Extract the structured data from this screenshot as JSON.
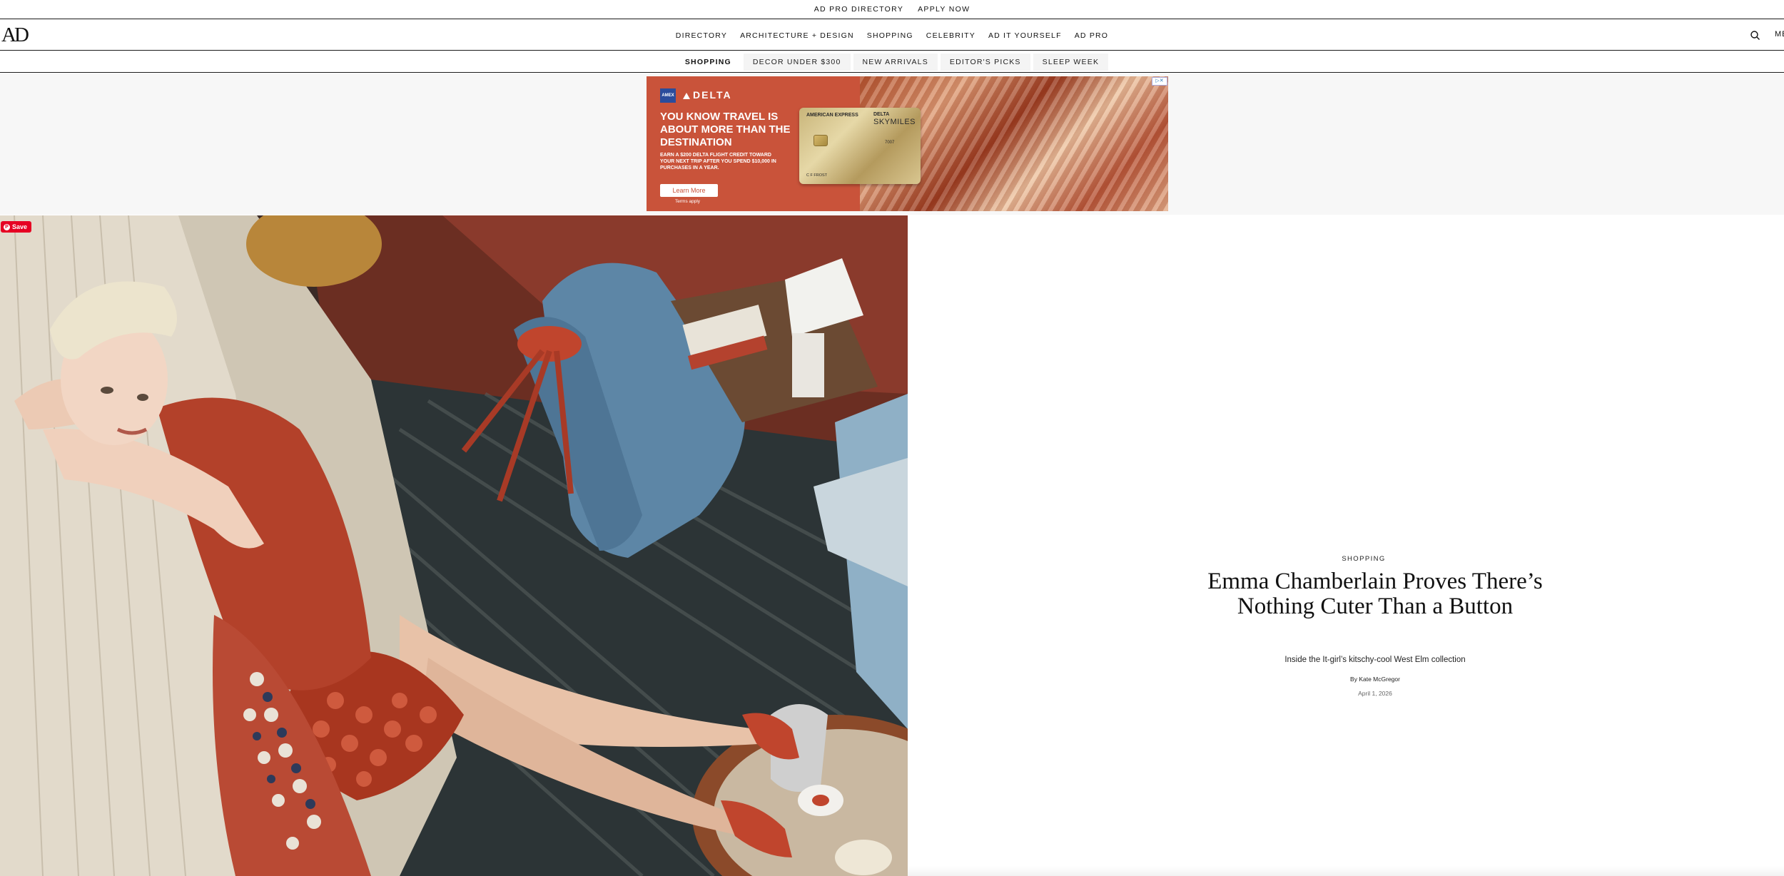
{
  "utility_bar": {
    "links": [
      "AD PRO DIRECTORY",
      "APPLY NOW"
    ]
  },
  "header": {
    "logo": "AD",
    "nav": [
      "DIRECTORY",
      "ARCHITECTURE + DESIGN",
      "SHOPPING",
      "CELEBRITY",
      "AD IT YOURSELF",
      "AD PRO"
    ],
    "menu_label": "MENU",
    "search_icon": "search-icon"
  },
  "sub_nav": {
    "current": "SHOPPING",
    "items": [
      "DECOR UNDER $300",
      "NEW ARRIVALS",
      "EDITOR'S PICKS",
      "SLEEP WEEK"
    ]
  },
  "ad": {
    "brand": "DELTA",
    "badge": "AMEX",
    "headline": "YOU KNOW TRAVEL IS ABOUT MORE THAN THE DESTINATION",
    "body": "EARN A $200 DELTA FLIGHT CREDIT TOWARD YOUR NEXT TRIP AFTER YOU SPEND $10,000 IN PURCHASES IN A YEAR.",
    "cta": "Learn More",
    "terms": "Terms apply",
    "card": {
      "issuer": "AMERICAN EXPRESS",
      "partner": "DELTA",
      "program": "SKYMILES",
      "number": "7007",
      "holder": "C F FROST"
    },
    "choices_icon": "adchoices-icon",
    "colors": {
      "panel": "#c9533a",
      "card": "#d6c38b"
    }
  },
  "hero": {
    "save_label": "Save"
  },
  "article": {
    "rubric": "SHOPPING",
    "headline": "Emma Chamberlain Proves There’s Nothing Cuter Than a Button",
    "dek": "Inside the It-girl’s kitschy-cool West Elm collection",
    "byline_prefix": "By",
    "author": "Kate McGregor",
    "date": "April 1, 2026"
  }
}
